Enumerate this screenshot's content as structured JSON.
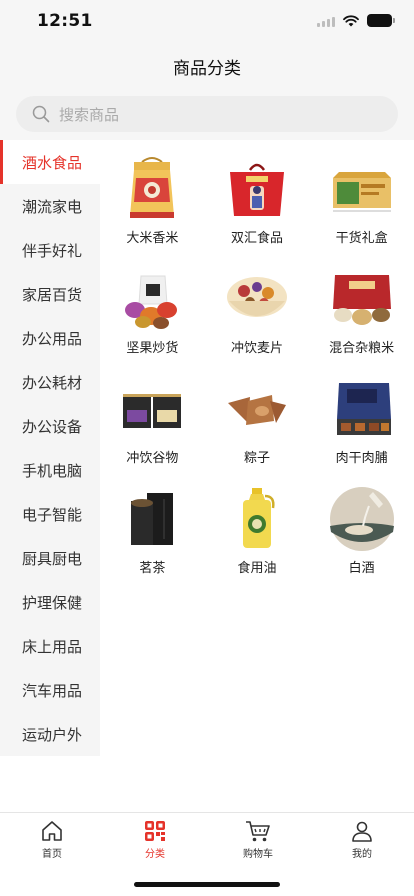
{
  "status": {
    "time": "12:51"
  },
  "nav": {
    "title": "商品分类"
  },
  "search": {
    "placeholder": "搜索商品"
  },
  "sidebar": {
    "items": [
      {
        "label": "酒水食品",
        "active": true
      },
      {
        "label": "潮流家电"
      },
      {
        "label": "伴手好礼"
      },
      {
        "label": "家居百货"
      },
      {
        "label": "办公用品"
      },
      {
        "label": "办公耗材"
      },
      {
        "label": "办公设备"
      },
      {
        "label": "手机电脑"
      },
      {
        "label": "电子智能"
      },
      {
        "label": "厨具厨电"
      },
      {
        "label": "护理保健"
      },
      {
        "label": "床上用品"
      },
      {
        "label": "汽车用品"
      },
      {
        "label": "运动户外"
      }
    ]
  },
  "products": [
    {
      "label": "大米香米",
      "icon": "rice-gift-bag-icon"
    },
    {
      "label": "双汇食品",
      "icon": "shuanghui-gift-box-icon"
    },
    {
      "label": "干货礼盒",
      "icon": "dried-goods-box-icon"
    },
    {
      "label": "坚果炒货",
      "icon": "nuts-icon"
    },
    {
      "label": "冲饮麦片",
      "icon": "cereal-bowl-icon"
    },
    {
      "label": "混合杂粮米",
      "icon": "mixed-grains-icon"
    },
    {
      "label": "冲饮谷物",
      "icon": "grain-drink-icon"
    },
    {
      "label": "粽子",
      "icon": "zongzi-icon"
    },
    {
      "label": "肉干肉脯",
      "icon": "jerky-icon"
    },
    {
      "label": "茗茶",
      "icon": "tea-icon"
    },
    {
      "label": "食用油",
      "icon": "cooking-oil-icon"
    },
    {
      "label": "白酒",
      "icon": "baijiu-icon"
    }
  ],
  "tabs": [
    {
      "label": "首页",
      "icon": "home-icon"
    },
    {
      "label": "分类",
      "icon": "category-icon",
      "active": true
    },
    {
      "label": "购物车",
      "icon": "cart-icon"
    },
    {
      "label": "我的",
      "icon": "user-icon"
    }
  ],
  "colors": {
    "accent": "#e5332a",
    "background": "#f6f6f6"
  }
}
